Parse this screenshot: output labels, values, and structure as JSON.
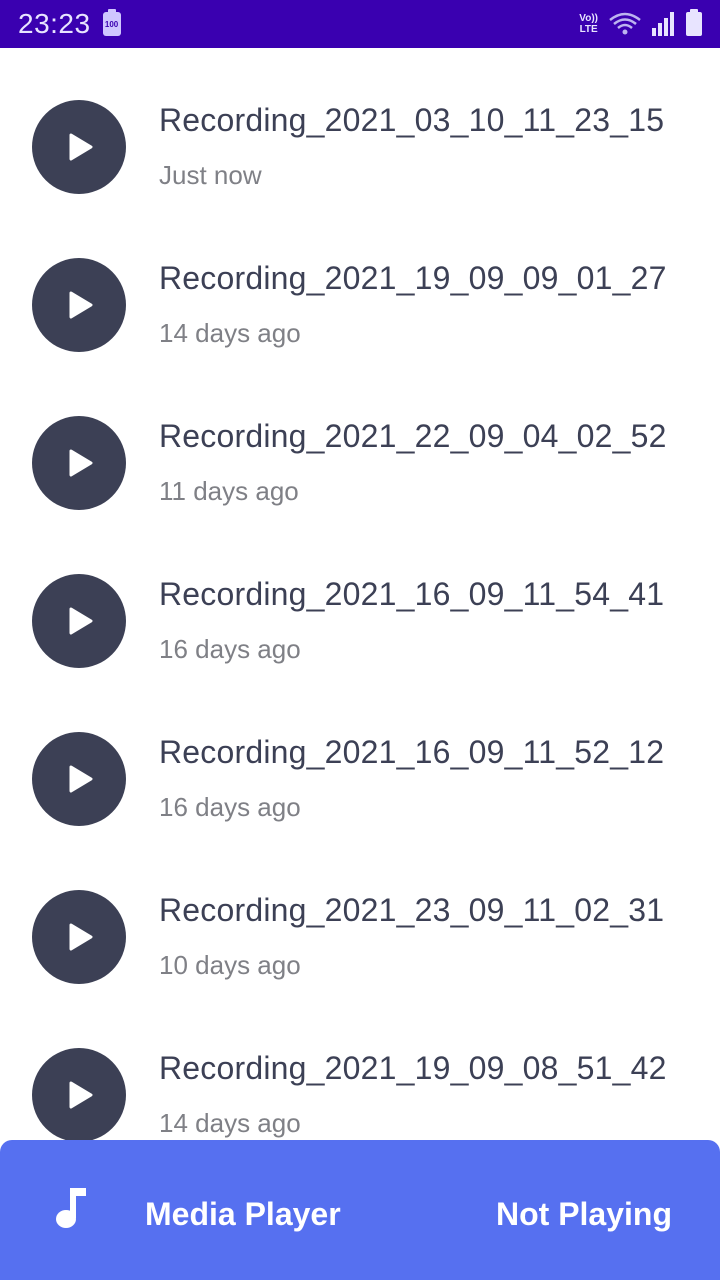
{
  "status_bar": {
    "time": "23:23",
    "battery_level": "100",
    "network_line1": "Vo))",
    "network_line2": "LTE"
  },
  "recordings": [
    {
      "title": "Recording_2021_03_10_11_23_15",
      "time": "Just now"
    },
    {
      "title": "Recording_2021_19_09_09_01_27",
      "time": "14 days ago"
    },
    {
      "title": "Recording_2021_22_09_04_02_52",
      "time": "11 days ago"
    },
    {
      "title": "Recording_2021_16_09_11_54_41",
      "time": "16 days ago"
    },
    {
      "title": "Recording_2021_16_09_11_52_12",
      "time": "16 days ago"
    },
    {
      "title": "Recording_2021_23_09_11_02_31",
      "time": "10 days ago"
    },
    {
      "title": "Recording_2021_19_09_08_51_42",
      "time": "14 days ago"
    }
  ],
  "media_bar": {
    "icon": "music-note-icon",
    "label": "Media Player",
    "status": "Not Playing"
  },
  "colors": {
    "status_bar": "#3a00b0",
    "play_button": "#3c4055",
    "media_bar": "#5670f0"
  }
}
